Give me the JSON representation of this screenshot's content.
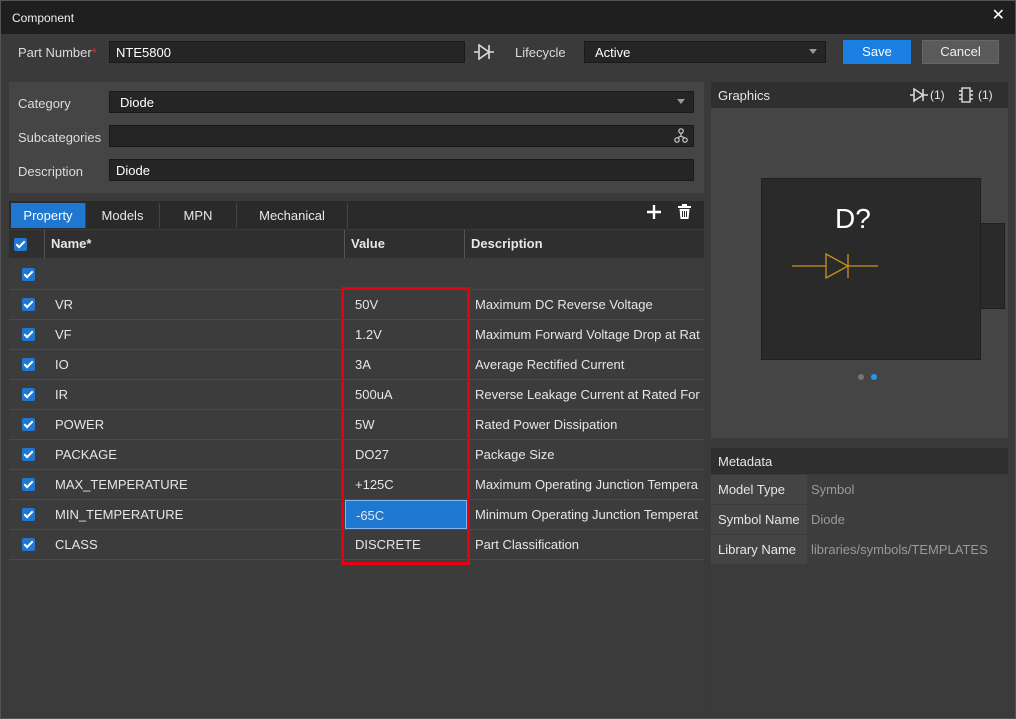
{
  "window": {
    "title": "Component",
    "close_icon": "close-icon"
  },
  "header": {
    "part_number_label": "Part Number",
    "required_mark": "*",
    "part_number_value": "NTE5800",
    "lifecycle_label": "Lifecycle",
    "lifecycle_value": "Active",
    "save_label": "Save",
    "cancel_label": "Cancel"
  },
  "form": {
    "category_label": "Category",
    "category_value": "Diode",
    "subcategories_label": "Subcategories",
    "subcategories_value": "",
    "description_label": "Description",
    "description_value": "Diode"
  },
  "tabs": [
    {
      "label": "Property",
      "active": true
    },
    {
      "label": "Models",
      "active": false
    },
    {
      "label": "MPN",
      "active": false
    },
    {
      "label": "Mechanical",
      "active": false
    }
  ],
  "table": {
    "columns": [
      "Name*",
      "Value",
      "Description"
    ],
    "rows": [
      {
        "checked": true,
        "name": "",
        "value": "",
        "description": ""
      },
      {
        "checked": true,
        "name": "VR",
        "value": "50V",
        "description": "Maximum DC Reverse Voltage"
      },
      {
        "checked": true,
        "name": "VF",
        "value": "1.2V",
        "description": "Maximum Forward Voltage Drop at Rat"
      },
      {
        "checked": true,
        "name": "IO",
        "value": "3A",
        "description": "Average Rectified Current"
      },
      {
        "checked": true,
        "name": "IR",
        "value": "500uA",
        "description": "Reverse Leakage Current at Rated Forw"
      },
      {
        "checked": true,
        "name": "POWER",
        "value": "5W",
        "description": "Rated Power Dissipation"
      },
      {
        "checked": true,
        "name": "PACKAGE",
        "value": "DO27",
        "description": "Package Size"
      },
      {
        "checked": true,
        "name": "MAX_TEMPERATURE",
        "value": "+125C",
        "description": "Maximum Operating Junction Tempera"
      },
      {
        "checked": true,
        "name": "MIN_TEMPERATURE",
        "value": "-65C",
        "description": "Minimum Operating Junction Temperat",
        "selected": true
      },
      {
        "checked": true,
        "name": "CLASS",
        "value": "DISCRETE",
        "description": "Part Classification"
      }
    ]
  },
  "graphics": {
    "title": "Graphics",
    "symbol_count": "(1)",
    "footprint_count": "(1)",
    "refdes": "D?"
  },
  "metadata": {
    "title": "Metadata",
    "rows": [
      {
        "key": "Model Type",
        "value": "Symbol"
      },
      {
        "key": "Symbol Name",
        "value": "Diode"
      },
      {
        "key": "Library Name",
        "value": "libraries/symbols/TEMPLATES"
      }
    ]
  },
  "colors": {
    "accent": "#1e78d2",
    "highlight_box": "#e8000e",
    "diode_symbol": "#c8921e"
  }
}
